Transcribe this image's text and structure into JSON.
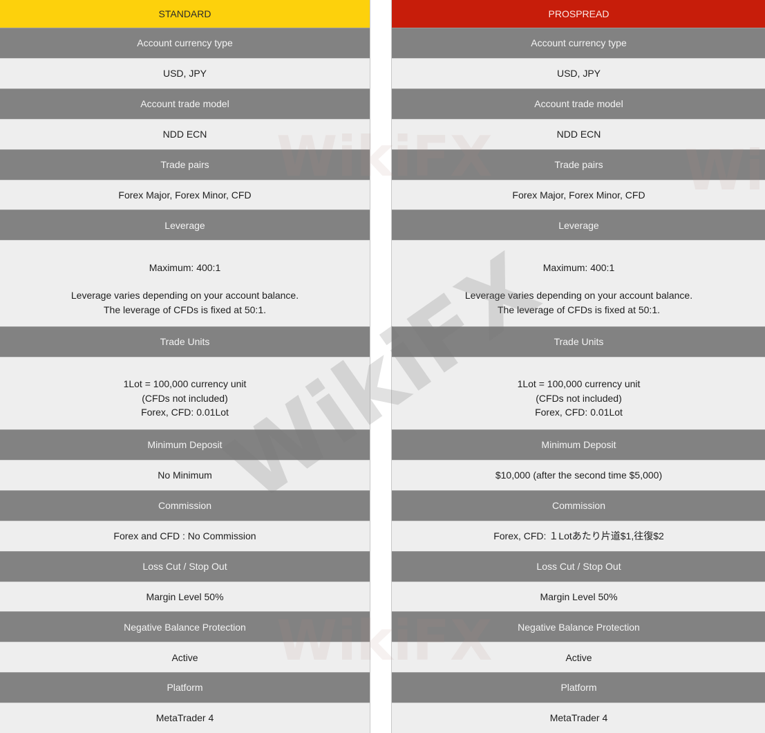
{
  "columns": [
    {
      "title": "STANDARD",
      "accent_color": "#fdd10c",
      "rows": [
        {
          "label": "Account currency type",
          "value": [
            "USD, JPY"
          ]
        },
        {
          "label": "Account trade model",
          "value": [
            "NDD ECN"
          ]
        },
        {
          "label": "Trade pairs",
          "value": [
            "Forex Major, Forex Minor, CFD"
          ]
        },
        {
          "label": "Leverage",
          "value": [
            "Maximum: 400:1",
            "",
            "Leverage varies depending on your account balance.",
            "The leverage of CFDs is fixed at 50:1."
          ]
        },
        {
          "label": "Trade Units",
          "value": [
            "1Lot = 100,000 currency unit",
            "(CFDs not included)",
            "Forex, CFD: 0.01Lot"
          ]
        },
        {
          "label": "Minimum Deposit",
          "value": [
            "No Minimum"
          ]
        },
        {
          "label": "Commission",
          "value": [
            "Forex and CFD : No Commission"
          ]
        },
        {
          "label": "Loss Cut / Stop Out",
          "value": [
            "Margin Level 50%"
          ]
        },
        {
          "label": "Negative Balance Protection",
          "value": [
            "Active"
          ]
        },
        {
          "label": "Platform",
          "value": [
            "MetaTrader 4"
          ]
        }
      ]
    },
    {
      "title": "PROSPREAD",
      "accent_color": "#c71d0a",
      "rows": [
        {
          "label": "Account currency type",
          "value": [
            "USD, JPY"
          ]
        },
        {
          "label": "Account trade model",
          "value": [
            "NDD ECN"
          ]
        },
        {
          "label": "Trade pairs",
          "value": [
            "Forex Major, Forex Minor, CFD"
          ]
        },
        {
          "label": "Leverage",
          "value": [
            "Maximum: 400:1",
            "",
            "Leverage varies depending on your account balance.",
            "The leverage of CFDs is fixed at 50:1."
          ]
        },
        {
          "label": "Trade Units",
          "value": [
            "1Lot = 100,000 currency unit",
            "(CFDs not included)",
            "Forex, CFD: 0.01Lot"
          ]
        },
        {
          "label": "Minimum Deposit",
          "value": [
            "$10,000 (after the second time $5,000)"
          ]
        },
        {
          "label": "Commission",
          "value": [
            "Forex, CFD: １Lotあたり片道$1,往復$2"
          ]
        },
        {
          "label": "Loss Cut / Stop Out",
          "value": [
            "Margin Level 50%"
          ]
        },
        {
          "label": "Negative Balance Protection",
          "value": [
            "Active"
          ]
        },
        {
          "label": "Platform",
          "value": [
            "MetaTrader 4"
          ]
        }
      ]
    }
  ],
  "watermark": {
    "text": "WikiFX"
  }
}
